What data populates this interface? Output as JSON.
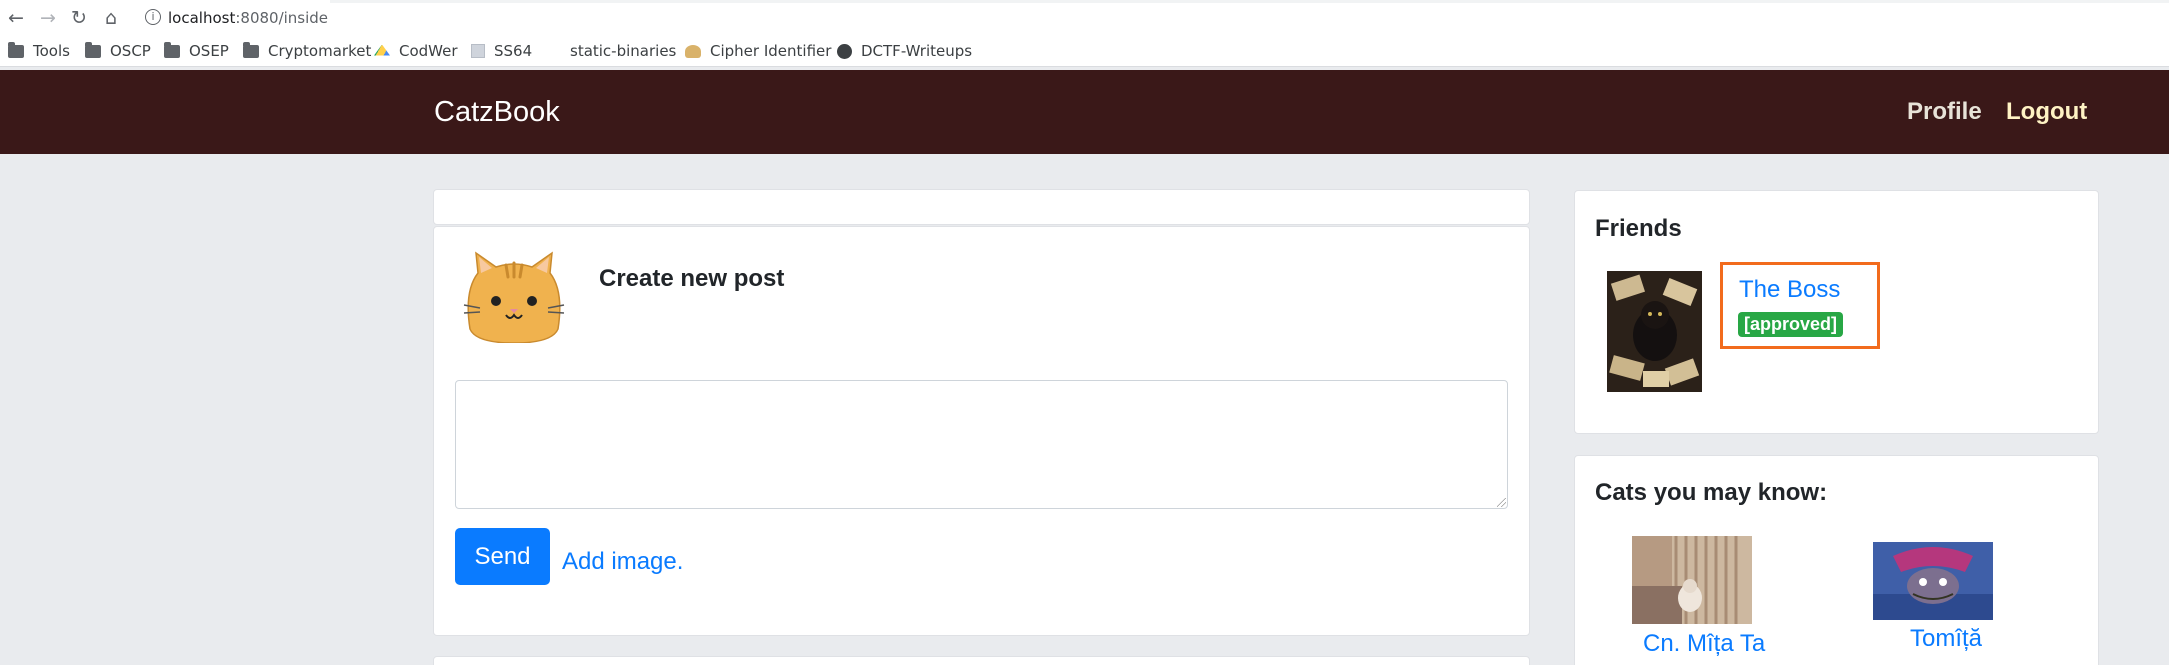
{
  "browser": {
    "nav_icons": {
      "back": "←",
      "forward": "→",
      "reload": "↻",
      "home": "⌂",
      "info": "i"
    },
    "url_host": "localhost",
    "url_rest": ":8080/inside"
  },
  "bookmarks": [
    {
      "label": "Tools",
      "icon": "folder-icon"
    },
    {
      "label": "OSCP",
      "icon": "folder-icon"
    },
    {
      "label": "OSEP",
      "icon": "folder-icon"
    },
    {
      "label": "Cryptomarket",
      "icon": "folder-icon"
    },
    {
      "label": "CodWer",
      "icon": "google-drive-icon"
    },
    {
      "label": "SS64",
      "icon": "page-icon"
    },
    {
      "label": "static-binaries",
      "icon": "none"
    },
    {
      "label": "Cipher Identifier",
      "icon": "burger-icon"
    },
    {
      "label": "DCTF-Writeups",
      "icon": "globe-icon"
    }
  ],
  "navbar": {
    "brand": "CatzBook",
    "profile": "Profile",
    "logout": "Logout",
    "background": "#3a1818"
  },
  "post": {
    "title": "Create new post",
    "textarea_value": "",
    "send_label": "Send",
    "add_image_label": "Add image."
  },
  "friends": {
    "title": "Friends",
    "items": [
      {
        "name": "The Boss",
        "status": "[approved]"
      }
    ]
  },
  "suggestions": {
    "title": "Cats you may know:",
    "items": [
      {
        "name": "Cn. Mîța Ta"
      },
      {
        "name": "Tomîță"
      }
    ]
  },
  "colors": {
    "link": "#0a7bff",
    "badge": "#28a745",
    "highlight": "#f26b1d",
    "page_bg": "#e9ebee"
  }
}
